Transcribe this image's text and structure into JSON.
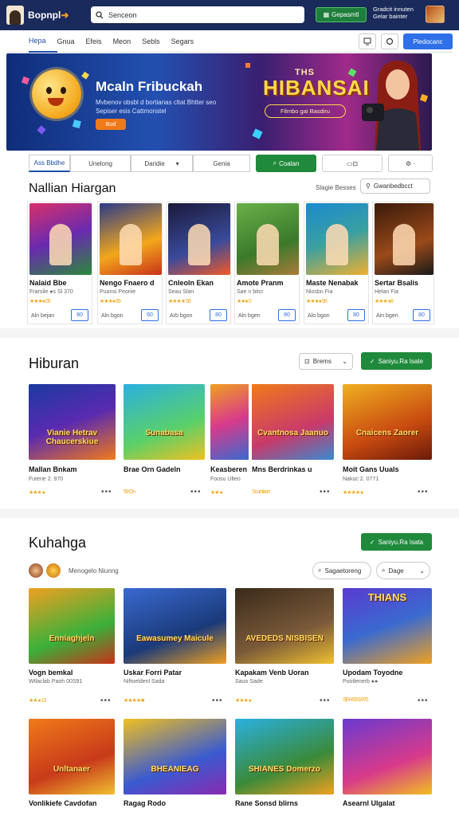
{
  "header": {
    "brand": "Bopnpl",
    "brand_dot": "●",
    "search_placeholder": "Senceon",
    "cta_label": "Gepasmtl",
    "promo_text": "Gradcit innuten Gelar bainter",
    "colors": {
      "bar": "#1a2a5a",
      "accent": "#1f8a3c"
    }
  },
  "nav": {
    "items": [
      "Hepa",
      "Gnua",
      "Efeis",
      "Meon",
      "Sebls",
      "Segars"
    ],
    "active_index": 0,
    "cta_label": "Pledocanc"
  },
  "hero": {
    "title": "Mcaln Fribuckah",
    "subtitle": "Mvbenov obsbl d bortianas cltat Bhtter seo Sepiser esis Cattmonstel",
    "button": "Bud",
    "small_title": "THS",
    "big_title": "HIBANSAI",
    "pill": "Filmbo gai Basdiru"
  },
  "filters": {
    "tabs": [
      "Ass Bbdhe",
      "Unelong",
      "Daridie",
      "Genia"
    ],
    "active_index": 0,
    "dropdown_icon": "chevron-down-icon",
    "search_button": "Coalan"
  },
  "section1": {
    "title": "Nallian Hiargan",
    "right_text": "Slagie Besses",
    "right_pill": "Gwanbedbcct",
    "cards": [
      {
        "title": "Nalaid Bbe",
        "sub": "Frarsile ●s Sl 370",
        "rating": "★★★● 05",
        "left_btn": "Aln bejan",
        "right_btn": "80"
      },
      {
        "title": "Nengo Fnaero d",
        "sub": "Puansi Peoriie",
        "rating": "★★★● 69",
        "left_btn": "Aln bgon",
        "right_btn": "60"
      },
      {
        "title": "Cnleoln Ekan",
        "sub": "Seau Slan",
        "rating": "★★★★ 58",
        "left_btn": "Arb bgon",
        "right_btn": "80"
      },
      {
        "title": "Amote Pranm",
        "sub": "Sae n bitcr",
        "rating": "★★● 0",
        "left_btn": "Aln bgen",
        "right_btn": "80"
      },
      {
        "title": "Maste Nenabak",
        "sub": "Nlosbn Fia",
        "rating": "★★★● 58",
        "left_btn": "Alo bgon",
        "right_btn": "80"
      },
      {
        "title": "Sertar Bsalis",
        "sub": "Helan Fia",
        "rating": "★★★ ●9",
        "left_btn": "Ain bgen",
        "right_btn": "80"
      }
    ]
  },
  "section2": {
    "title": "Hiburan",
    "dropdown_label": "Brems",
    "green_button": "Saniyu.Ra Isate",
    "cards": [
      {
        "title": "Mallan Bnkam",
        "sub": "Futerie 2. 970",
        "meta": "★★★ ●",
        "thumb_text": "Vianie Hetrav Chaucerskiue"
      },
      {
        "title": "Brae Orn Gadeln",
        "sub": "",
        "meta": "59 On",
        "thumb_text": "Sunabasa"
      },
      {
        "title": "Keasberen",
        "sub": "Foosu Ulteo",
        "meta": "★★ ●",
        "thumb_text": ""
      },
      {
        "title": "Mns Berdrinkas u",
        "sub": "",
        "meta": "Scurnlaon",
        "thumb_text": "Cvantnosa Jaanuo"
      },
      {
        "title": "Moit Gans Uuals",
        "sub": "Nakuc 2. 0771",
        "meta": "★★★★ ●",
        "thumb_text": "Cnaicens Zaorer"
      }
    ]
  },
  "section3": {
    "title": "Kuhahga",
    "green_button": "Saniyu.Ra Isata",
    "tag_label": "Menogelo Niunng",
    "search_pill": "Sagaetoreng",
    "sort_pill": "Dage",
    "cards": [
      {
        "title": "Vogn bemkal",
        "sub": "Wtlaclab Paoh 00S91",
        "meta": "★★ ● 13",
        "thumb_text": "Enniaghjeln"
      },
      {
        "title": "Uskar Forri Patar",
        "sub": "Niftoeldenl Sada",
        "meta": "★★★★ ■",
        "thumb_text": "Eawasumey Maicule"
      },
      {
        "title": "Kapakam Venb Uoran",
        "sub": "Sauo Sade",
        "meta": "★★★ ●",
        "thumb_text": "AVEDEDS NISBISEN"
      },
      {
        "title": "Upodam Toyodne",
        "sub": "Pootlenerb ●●",
        "meta": "SEHS9 9.970",
        "thumb_text": "THIANS"
      },
      {
        "title": "Vonlikiefe Cavdofan",
        "sub": "",
        "meta": "",
        "thumb_text": "Unltanaer"
      },
      {
        "title": "Ragag Rodo",
        "sub": "",
        "meta": "",
        "thumb_text": "BHEANIEAG"
      },
      {
        "title": "Rane Sonsd blirns",
        "sub": "",
        "meta": "",
        "thumb_text": "SHIANES Domerzo"
      },
      {
        "title": "Asearnl Ulgalat",
        "sub": "",
        "meta": "",
        "thumb_text": ""
      }
    ]
  }
}
